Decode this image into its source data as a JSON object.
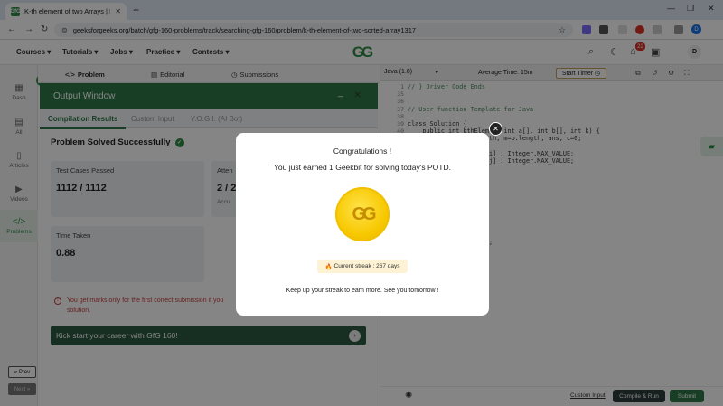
{
  "browser": {
    "tab_title": "K-th element of two Arrays | Pr",
    "tab_favicon": "GfG",
    "url": "geeksforgeeks.org/batch/gfg-160-problems/track/searching-gfg-160/problem/k-th-element-of-two-sorted-array1317",
    "profile_initial": "D"
  },
  "header": {
    "nav": [
      "Courses",
      "Tutorials",
      "Jobs",
      "Practice",
      "Contests"
    ],
    "logo": "GG",
    "notification_count": "22",
    "user_initial": "D"
  },
  "sidebar": {
    "items": [
      {
        "label": "Dash",
        "icon": "dashboard-icon"
      },
      {
        "label": "All",
        "icon": "grid-icon"
      },
      {
        "label": "Articles",
        "icon": "book-icon"
      },
      {
        "label": "Videos",
        "icon": "video-icon"
      },
      {
        "label": "Problems",
        "icon": "code-icon"
      }
    ],
    "prev_label": "« Prev",
    "next_label": "Next »"
  },
  "problem_tabs": [
    "Problem",
    "Editorial",
    "Submissions"
  ],
  "output_window": {
    "title": "Output Window",
    "tabs": [
      "Compilation Results",
      "Custom Input",
      "Y.O.G.I. (AI Bot)"
    ],
    "status": "Problem Solved Successfully",
    "cards": {
      "test_cases_label": "Test Cases Passed",
      "test_cases_value": "1112 / 1112",
      "attempts_label": "Atten",
      "attempts_value": "2 / 2",
      "attempts_sub": "Accu",
      "time_label": "Time Taken",
      "time_value": "0.88"
    },
    "warning": "You get marks only for the first correct submission if you solution.",
    "kickstart": "Kick start your career with GfG 160!"
  },
  "editor": {
    "language": "Java (1.8)",
    "avg_time": "Average Time: 15m",
    "start_timer": "Start Timer",
    "lines": [
      {
        "n": "1",
        "t": "// } Driver Code Ends"
      },
      {
        "n": "35",
        "t": ""
      },
      {
        "n": "36",
        "t": ""
      },
      {
        "n": "37",
        "t": "// User function Template for Java"
      },
      {
        "n": "38",
        "t": ""
      },
      {
        "n": "39",
        "t": "class Solution {"
      },
      {
        "n": "40",
        "t": "    public int kthElement(int a[], int b[], int k) {"
      },
      {
        "n": "41",
        "t": "        int n = a.length, m=b.length, ans, c=0;"
      },
      {
        "n": "42",
        "t": ""
      },
      {
        "n": "43",
        "t": "        int x = n ? a[i] : Integer.MAX_VALUE;"
      },
      {
        "n": "44",
        "t": "        int y = m ? b[j] : Integer.MAX_VALUE;"
      },
      {
        "n": "45",
        "t": "        if(x<y) {"
      },
      {
        "n": "46",
        "t": ""
      },
      {
        "n": "47",
        "t": "            i++;"
      },
      {
        "n": "48",
        "t": ""
      },
      {
        "n": "49",
        "t": ""
      },
      {
        "n": "50",
        "t": ""
      },
      {
        "n": "51",
        "t": "            j++;"
      },
      {
        "n": "52",
        "t": ""
      },
      {
        "n": "53",
        "t": ""
      },
      {
        "n": "54",
        "t": "        if(c==k) {"
      },
      {
        "n": "55",
        "t": "            return ans;"
      }
    ],
    "custom_input": "Custom Input",
    "compile_run": "Compile & Run",
    "submit": "Submit"
  },
  "modal": {
    "title": "Congratulations !",
    "message": "You just earned 1 Geekbit for solving today's POTD.",
    "streak": "Current streak : 267 days",
    "footer": "Keep up your streak to earn more. See you tomorrow !"
  }
}
